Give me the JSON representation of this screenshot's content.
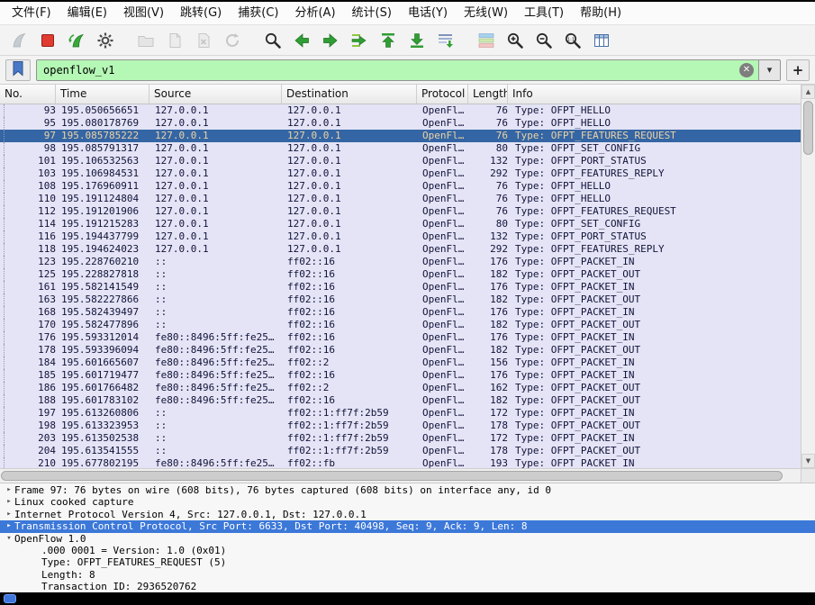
{
  "menubar": {
    "items": [
      {
        "id": "file",
        "label": "文件(F)"
      },
      {
        "id": "edit",
        "label": "编辑(E)"
      },
      {
        "id": "view",
        "label": "视图(V)"
      },
      {
        "id": "go",
        "label": "跳转(G)"
      },
      {
        "id": "capture",
        "label": "捕获(C)"
      },
      {
        "id": "analyze",
        "label": "分析(A)"
      },
      {
        "id": "statistics",
        "label": "统计(S)"
      },
      {
        "id": "telephony",
        "label": "电话(Y)"
      },
      {
        "id": "wireless",
        "label": "无线(W)"
      },
      {
        "id": "tools",
        "label": "工具(T)"
      },
      {
        "id": "help",
        "label": "帮助(H)"
      }
    ]
  },
  "toolbar": {
    "buttons": [
      {
        "name": "start-capture",
        "icon": "fin-start",
        "enabled": false,
        "gap": false
      },
      {
        "name": "stop-capture",
        "icon": "stop",
        "enabled": true,
        "gap": false
      },
      {
        "name": "restart-capture",
        "icon": "fin-restart",
        "enabled": true,
        "gap": false
      },
      {
        "name": "capture-options",
        "icon": "gear",
        "enabled": true,
        "gap": false
      },
      {
        "name": "open-file",
        "icon": "folder",
        "enabled": false,
        "gap": true
      },
      {
        "name": "save-file",
        "icon": "save",
        "enabled": false,
        "gap": false
      },
      {
        "name": "close-file",
        "icon": "close-doc",
        "enabled": false,
        "gap": false
      },
      {
        "name": "reload-file",
        "icon": "reload",
        "enabled": false,
        "gap": false
      },
      {
        "name": "find-packet",
        "icon": "magnifier",
        "enabled": true,
        "gap": true
      },
      {
        "name": "go-back",
        "icon": "arrow-left",
        "enabled": true,
        "gap": false
      },
      {
        "name": "go-forward",
        "icon": "arrow-right",
        "enabled": true,
        "gap": false
      },
      {
        "name": "go-to-packet",
        "icon": "goto",
        "enabled": true,
        "gap": false
      },
      {
        "name": "go-first-packet",
        "icon": "arrow-top",
        "enabled": true,
        "gap": false
      },
      {
        "name": "go-last-packet",
        "icon": "arrow-bottom",
        "enabled": true,
        "gap": false
      },
      {
        "name": "auto-scroll",
        "icon": "autoscroll",
        "enabled": true,
        "gap": false
      },
      {
        "name": "colorize-packets",
        "icon": "colorize",
        "enabled": true,
        "gap": true
      },
      {
        "name": "zoom-in",
        "icon": "zoom-in",
        "enabled": true,
        "gap": false
      },
      {
        "name": "zoom-out",
        "icon": "zoom-out",
        "enabled": true,
        "gap": false
      },
      {
        "name": "zoom-original",
        "icon": "zoom-orig",
        "enabled": true,
        "gap": false
      },
      {
        "name": "resize-columns",
        "icon": "columns",
        "enabled": true,
        "gap": false
      }
    ]
  },
  "filter": {
    "value": "openflow_v1",
    "add_button_label": "+"
  },
  "icons": {
    "clear": "✕",
    "dropdown": "▾",
    "scroll_up": "▲",
    "scroll_down": "▼"
  },
  "packet_list": {
    "columns": [
      {
        "id": "no",
        "label": "No."
      },
      {
        "id": "time",
        "label": "Time"
      },
      {
        "id": "source",
        "label": "Source"
      },
      {
        "id": "destination",
        "label": "Destination"
      },
      {
        "id": "protocol",
        "label": "Protocol"
      },
      {
        "id": "length",
        "label": "Length"
      },
      {
        "id": "info",
        "label": "Info"
      }
    ],
    "rows": [
      {
        "no": "93",
        "time": "195.050656651",
        "source": "127.0.0.1",
        "destination": "127.0.0.1",
        "protocol": "OpenFl…",
        "length": "76",
        "info": "Type: OFPT_HELLO"
      },
      {
        "no": "95",
        "time": "195.080178769",
        "source": "127.0.0.1",
        "destination": "127.0.0.1",
        "protocol": "OpenFl…",
        "length": "76",
        "info": "Type: OFPT_HELLO"
      },
      {
        "no": "97",
        "time": "195.085785222",
        "source": "127.0.0.1",
        "destination": "127.0.0.1",
        "protocol": "OpenFl…",
        "length": "76",
        "info": "Type: OFPT_FEATURES_REQUEST",
        "selected": true
      },
      {
        "no": "98",
        "time": "195.085791317",
        "source": "127.0.0.1",
        "destination": "127.0.0.1",
        "protocol": "OpenFl…",
        "length": "80",
        "info": "Type: OFPT_SET_CONFIG"
      },
      {
        "no": "101",
        "time": "195.106532563",
        "source": "127.0.0.1",
        "destination": "127.0.0.1",
        "protocol": "OpenFl…",
        "length": "132",
        "info": "Type: OFPT_PORT_STATUS"
      },
      {
        "no": "103",
        "time": "195.106984531",
        "source": "127.0.0.1",
        "destination": "127.0.0.1",
        "protocol": "OpenFl…",
        "length": "292",
        "info": "Type: OFPT_FEATURES_REPLY"
      },
      {
        "no": "108",
        "time": "195.176960911",
        "source": "127.0.0.1",
        "destination": "127.0.0.1",
        "protocol": "OpenFl…",
        "length": "76",
        "info": "Type: OFPT_HELLO"
      },
      {
        "no": "110",
        "time": "195.191124804",
        "source": "127.0.0.1",
        "destination": "127.0.0.1",
        "protocol": "OpenFl…",
        "length": "76",
        "info": "Type: OFPT_HELLO"
      },
      {
        "no": "112",
        "time": "195.191201906",
        "source": "127.0.0.1",
        "destination": "127.0.0.1",
        "protocol": "OpenFl…",
        "length": "76",
        "info": "Type: OFPT_FEATURES_REQUEST"
      },
      {
        "no": "114",
        "time": "195.191215283",
        "source": "127.0.0.1",
        "destination": "127.0.0.1",
        "protocol": "OpenFl…",
        "length": "80",
        "info": "Type: OFPT_SET_CONFIG"
      },
      {
        "no": "116",
        "time": "195.194437799",
        "source": "127.0.0.1",
        "destination": "127.0.0.1",
        "protocol": "OpenFl…",
        "length": "132",
        "info": "Type: OFPT_PORT_STATUS"
      },
      {
        "no": "118",
        "time": "195.194624023",
        "source": "127.0.0.1",
        "destination": "127.0.0.1",
        "protocol": "OpenFl…",
        "length": "292",
        "info": "Type: OFPT_FEATURES_REPLY"
      },
      {
        "no": "123",
        "time": "195.228760210",
        "source": "::",
        "destination": "ff02::16",
        "protocol": "OpenFl…",
        "length": "176",
        "info": "Type: OFPT_PACKET_IN"
      },
      {
        "no": "125",
        "time": "195.228827818",
        "source": "::",
        "destination": "ff02::16",
        "protocol": "OpenFl…",
        "length": "182",
        "info": "Type: OFPT_PACKET_OUT"
      },
      {
        "no": "161",
        "time": "195.582141549",
        "source": "::",
        "destination": "ff02::16",
        "protocol": "OpenFl…",
        "length": "176",
        "info": "Type: OFPT_PACKET_IN"
      },
      {
        "no": "163",
        "time": "195.582227866",
        "source": "::",
        "destination": "ff02::16",
        "protocol": "OpenFl…",
        "length": "182",
        "info": "Type: OFPT_PACKET_OUT"
      },
      {
        "no": "168",
        "time": "195.582439497",
        "source": "::",
        "destination": "ff02::16",
        "protocol": "OpenFl…",
        "length": "176",
        "info": "Type: OFPT_PACKET_IN"
      },
      {
        "no": "170",
        "time": "195.582477896",
        "source": "::",
        "destination": "ff02::16",
        "protocol": "OpenFl…",
        "length": "182",
        "info": "Type: OFPT_PACKET_OUT"
      },
      {
        "no": "176",
        "time": "195.593312014",
        "source": "fe80::8496:5ff:fe25…",
        "destination": "ff02::16",
        "protocol": "OpenFl…",
        "length": "176",
        "info": "Type: OFPT_PACKET_IN"
      },
      {
        "no": "178",
        "time": "195.593396094",
        "source": "fe80::8496:5ff:fe25…",
        "destination": "ff02::16",
        "protocol": "OpenFl…",
        "length": "182",
        "info": "Type: OFPT_PACKET_OUT"
      },
      {
        "no": "184",
        "time": "195.601665607",
        "source": "fe80::8496:5ff:fe25…",
        "destination": "ff02::2",
        "protocol": "OpenFl…",
        "length": "156",
        "info": "Type: OFPT_PACKET_IN"
      },
      {
        "no": "185",
        "time": "195.601719477",
        "source": "fe80::8496:5ff:fe25…",
        "destination": "ff02::16",
        "protocol": "OpenFl…",
        "length": "176",
        "info": "Type: OFPT_PACKET_IN"
      },
      {
        "no": "186",
        "time": "195.601766482",
        "source": "fe80::8496:5ff:fe25…",
        "destination": "ff02::2",
        "protocol": "OpenFl…",
        "length": "162",
        "info": "Type: OFPT_PACKET_OUT"
      },
      {
        "no": "188",
        "time": "195.601783102",
        "source": "fe80::8496:5ff:fe25…",
        "destination": "ff02::16",
        "protocol": "OpenFl…",
        "length": "182",
        "info": "Type: OFPT_PACKET_OUT"
      },
      {
        "no": "197",
        "time": "195.613260806",
        "source": "::",
        "destination": "ff02::1:ff7f:2b59",
        "protocol": "OpenFl…",
        "length": "172",
        "info": "Type: OFPT_PACKET_IN"
      },
      {
        "no": "198",
        "time": "195.613323953",
        "source": "::",
        "destination": "ff02::1:ff7f:2b59",
        "protocol": "OpenFl…",
        "length": "178",
        "info": "Type: OFPT_PACKET_OUT"
      },
      {
        "no": "203",
        "time": "195.613502538",
        "source": "::",
        "destination": "ff02::1:ff7f:2b59",
        "protocol": "OpenFl…",
        "length": "172",
        "info": "Type: OFPT_PACKET_IN"
      },
      {
        "no": "204",
        "time": "195.613541555",
        "source": "::",
        "destination": "ff02::1:ff7f:2b59",
        "protocol": "OpenFl…",
        "length": "178",
        "info": "Type: OFPT_PACKET_OUT"
      },
      {
        "no": "210",
        "time": "195.677802195",
        "source": "fe80::8496:5ff:fe25…",
        "destination": "ff02::fb",
        "protocol": "OpenFl…",
        "length": "193",
        "info": "Type: OFPT_PACKET_IN"
      }
    ]
  },
  "detail_pane": {
    "lines": [
      {
        "expander": "collapsed",
        "indent": 0,
        "text": "Frame 97: 76 bytes on wire (608 bits), 76 bytes captured (608 bits) on interface any, id 0"
      },
      {
        "expander": "collapsed",
        "indent": 0,
        "text": "Linux cooked capture"
      },
      {
        "expander": "collapsed",
        "indent": 0,
        "text": "Internet Protocol Version 4, Src: 127.0.0.1, Dst: 127.0.0.1"
      },
      {
        "expander": "collapsed",
        "indent": 0,
        "selected": true,
        "text": "Transmission Control Protocol, Src Port: 6633, Dst Port: 40498, Seq: 9, Ack: 9, Len: 8"
      },
      {
        "expander": "expanded",
        "indent": 0,
        "text": "OpenFlow 1.0"
      },
      {
        "expander": "none",
        "indent": 1,
        "text": ".000 0001 = Version: 1.0 (0x01)"
      },
      {
        "expander": "none",
        "indent": 1,
        "text": "Type: OFPT_FEATURES_REQUEST (5)"
      },
      {
        "expander": "none",
        "indent": 1,
        "text": "Length: 8"
      },
      {
        "expander": "none",
        "indent": 1,
        "text": "Transaction ID: 2936520762"
      }
    ]
  },
  "colors": {
    "row_bg": "#e4e4f6",
    "selected_row_bg": "#3465a4",
    "selected_row_fg": "#ecd3a4",
    "detail_selected_bg": "#3c78d8",
    "filter_bg": "#b5f7b5",
    "accent_green": "#2f9e33",
    "stop_red": "#e03c31",
    "expert_icon_blue": "#3f74d8"
  }
}
